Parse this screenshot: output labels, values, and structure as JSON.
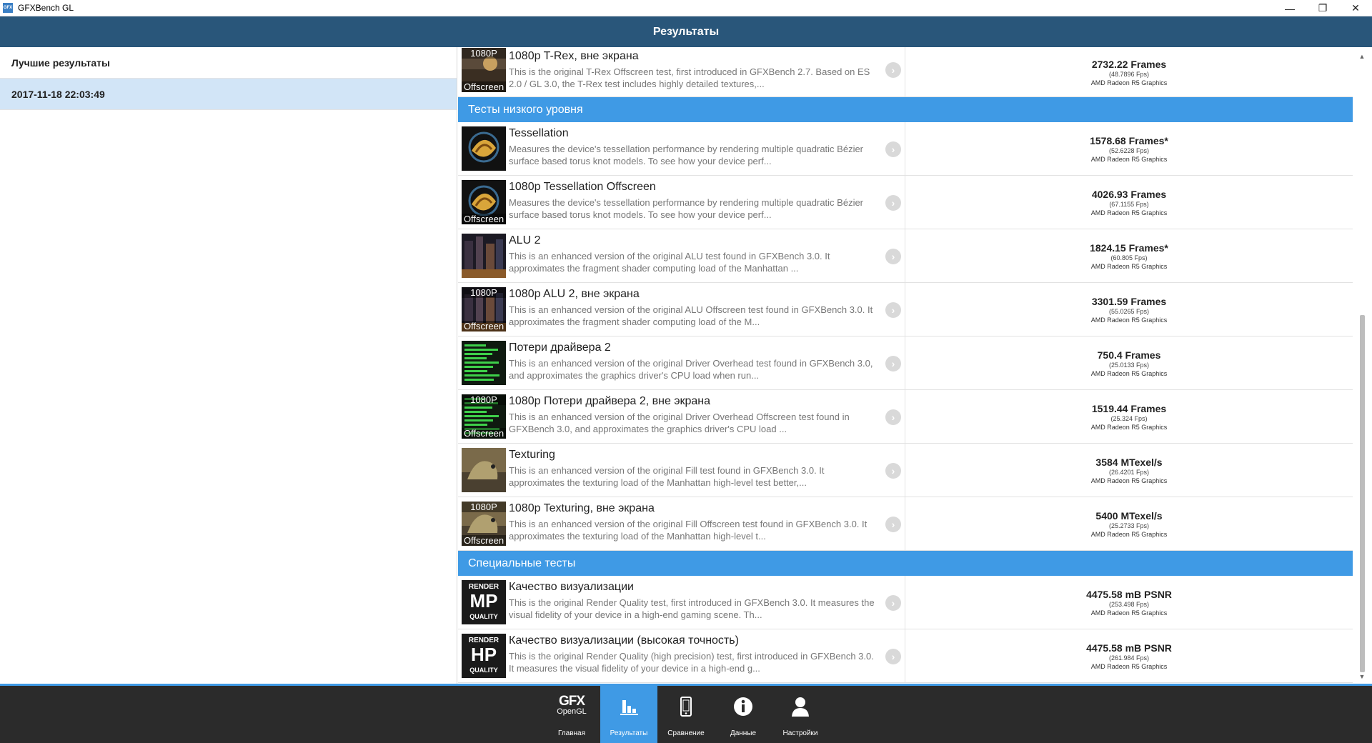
{
  "window": {
    "title": "GFXBench GL",
    "app_icon_label": "GFX",
    "minimize": "—",
    "restore": "❐",
    "close": "✕"
  },
  "header": {
    "title": "Результаты"
  },
  "sidebar": {
    "items": [
      {
        "label": "Лучшие результаты",
        "selected": false
      },
      {
        "label": "2017-11-18 22:03:49",
        "selected": true
      }
    ]
  },
  "list": {
    "top_row": {
      "name": "1080p T-Rex, вне экрана",
      "desc": "This is the original T-Rex Offscreen test, first introduced in GFXBench 2.7. Based on ES 2.0 / GL 3.0, the T-Rex test includes highly detailed textures,...",
      "score": "2732.22 Frames",
      "fps": "(48.7896 Fps)",
      "gpu": "AMD Radeon R5 Graphics",
      "tag_top": "1080P",
      "tag_bottom": "Offscreen"
    },
    "sections": [
      {
        "title": "Тесты низкого уровня",
        "rows": [
          {
            "name": "Tessellation",
            "desc": "Measures the device's tessellation performance by rendering multiple quadratic Bézier surface based torus knot models. To see how your device perf...",
            "score": "1578.68 Frames*",
            "fps": "(52.6228 Fps)",
            "gpu": "AMD Radeon R5 Graphics",
            "thumb": "tess",
            "tag_top": "",
            "tag_bottom": ""
          },
          {
            "name": "1080p Tessellation Offscreen",
            "desc": "Measures the device's tessellation performance by rendering multiple quadratic Bézier surface based torus knot models. To see how your device perf...",
            "score": "4026.93 Frames",
            "fps": "(67.1155 Fps)",
            "gpu": "AMD Radeon R5 Graphics",
            "thumb": "tess",
            "tag_top": "",
            "tag_bottom": "Offscreen"
          },
          {
            "name": "ALU 2",
            "desc": "This is an enhanced version of the original ALU test found in GFXBench 3.0. It approximates the fragment shader computing load of the Manhattan ...",
            "score": "1824.15 Frames*",
            "fps": "(60.805 Fps)",
            "gpu": "AMD Radeon R5 Graphics",
            "thumb": "city",
            "tag_top": "",
            "tag_bottom": ""
          },
          {
            "name": "1080p ALU 2, вне экрана",
            "desc": "This is an enhanced version of the original ALU Offscreen test found in GFXBench 3.0. It approximates the fragment shader computing load of the M...",
            "score": "3301.59 Frames",
            "fps": "(55.0265 Fps)",
            "gpu": "AMD Radeon R5 Graphics",
            "thumb": "city",
            "tag_top": "1080P",
            "tag_bottom": "Offscreen"
          },
          {
            "name": "Потери драйвера 2",
            "desc": "This is an enhanced version of the original Driver Overhead test found in GFXBench 3.0, and approximates the graphics driver's CPU load when run...",
            "score": "750.4 Frames",
            "fps": "(25.0133 Fps)",
            "gpu": "AMD Radeon R5 Graphics",
            "thumb": "driver",
            "tag_top": "",
            "tag_bottom": ""
          },
          {
            "name": "1080p Потери драйвера 2, вне экрана",
            "desc": "This is an enhanced version of the original Driver Overhead Offscreen test found in GFXBench 3.0, and approximates the graphics driver's CPU load ...",
            "score": "1519.44 Frames",
            "fps": "(25.324 Fps)",
            "gpu": "AMD Radeon R5 Graphics",
            "thumb": "driver",
            "tag_top": "1080P",
            "tag_bottom": "Offscreen"
          },
          {
            "name": "Texturing",
            "desc": "This is an enhanced version of the original Fill test found in GFXBench 3.0. It approximates the texturing load of the Manhattan high-level test better,...",
            "score": "3584 MTexel/s",
            "fps": "(26.4201 Fps)",
            "gpu": "AMD Radeon R5 Graphics",
            "thumb": "dino",
            "tag_top": "",
            "tag_bottom": ""
          },
          {
            "name": "1080p Texturing, вне экрана",
            "desc": "This is an enhanced version of the original Fill Offscreen test found in GFXBench 3.0. It approximates the texturing load of the Manhattan high-level t...",
            "score": "5400 MTexel/s",
            "fps": "(25.2733 Fps)",
            "gpu": "AMD Radeon R5 Graphics",
            "thumb": "dino",
            "tag_top": "1080P",
            "tag_bottom": "Offscreen"
          }
        ]
      },
      {
        "title": "Специальные тесты",
        "rows": [
          {
            "name": "Качество визуализации",
            "desc": "This is the original Render Quality test, first introduced in GFXBench 3.0. It measures the visual fidelity of your device in a high-end gaming scene. Th...",
            "score": "4475.58 mB PSNR",
            "fps": "(253.498 Fps)",
            "gpu": "AMD Radeon R5 Graphics",
            "thumb": "render",
            "render_top": "RENDER",
            "render_mid": "MP",
            "render_bot": "QUALITY"
          },
          {
            "name": "Качество визуализации (высокая точность)",
            "desc": "This is the original Render Quality (high precision) test, first introduced in GFXBench 3.0. It measures the visual fidelity of your device in a high-end g...",
            "score": "4475.58 mB PSNR",
            "fps": "(261.984 Fps)",
            "gpu": "AMD Radeon R5 Graphics",
            "thumb": "render",
            "render_top": "RENDER",
            "render_mid": "HP",
            "render_bot": "QUALITY"
          }
        ]
      }
    ]
  },
  "scrollbar": {
    "up": "▲",
    "down": "▼"
  },
  "bottom_nav": {
    "logo_line1": "GFX",
    "logo_line2": "OpenGL",
    "items": [
      {
        "label": "Главная",
        "icon": "gfx-logo-icon",
        "active": false
      },
      {
        "label": "Результаты",
        "icon": "bar-chart-icon",
        "active": true
      },
      {
        "label": "Сравнение",
        "icon": "phone-icon",
        "active": false
      },
      {
        "label": "Данные",
        "icon": "info-icon",
        "active": false
      },
      {
        "label": "Настройки",
        "icon": "user-icon",
        "active": false
      }
    ]
  },
  "colors": {
    "header_bg": "#29567a",
    "section_bg": "#3f9ae5",
    "selected_bg": "#d2e5f7",
    "nav_bg": "#2b2b2b",
    "nav_active": "#3f9ae5"
  }
}
